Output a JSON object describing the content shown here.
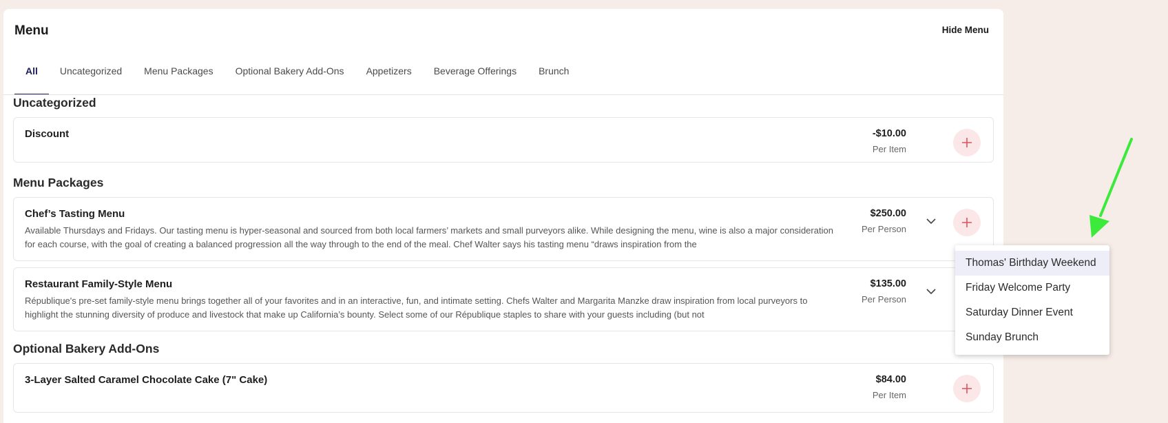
{
  "header": {
    "title": "Menu",
    "hide_label": "Hide Menu"
  },
  "tabs": [
    {
      "label": "All",
      "active": true
    },
    {
      "label": "Uncategorized"
    },
    {
      "label": "Menu Packages"
    },
    {
      "label": "Optional Bakery Add-Ons"
    },
    {
      "label": "Appetizers"
    },
    {
      "label": "Beverage Offerings"
    },
    {
      "label": "Brunch"
    }
  ],
  "sections": {
    "uncategorized": {
      "title": "Uncategorized",
      "items": [
        {
          "name": "Discount",
          "price": "-$10.00",
          "unit": "Per Item"
        }
      ]
    },
    "menu_packages": {
      "title": "Menu Packages",
      "items": [
        {
          "name": "Chef’s Tasting Menu",
          "description": "Available Thursdays and Fridays. Our tasting menu is hyper-seasonal and sourced from both local farmers’ markets and small purveyors alike. While designing the menu, wine is also a major consideration for each course, with the goal of creating a balanced progression all the way through to the end of the meal. Chef Walter says his tasting menu “draws inspiration from the",
          "price": "$250.00",
          "unit": "Per Person"
        },
        {
          "name": "Restaurant Family-Style Menu",
          "description": "République's pre-set family-style menu brings together all of your favorites and in an interactive, fun, and intimate setting. Chefs Walter and Margarita Manzke draw inspiration from local purveyors to highlight the stunning diversity of produce and livestock that make up California’s bounty. Select some of our République staples to share with your guests including (but not",
          "price": "$135.00",
          "unit": "Per Person"
        }
      ]
    },
    "bakery": {
      "title": "Optional Bakery Add-Ons",
      "items": [
        {
          "name": "3-Layer Salted Caramel Chocolate Cake (7\" Cake)",
          "price": "$84.00",
          "unit": "Per Item"
        }
      ]
    }
  },
  "dropdown": {
    "options": [
      "Thomas' Birthday Weekend",
      "Friday Welcome Party",
      "Saturday Dinner Event",
      "Sunday Brunch"
    ],
    "highlighted_index": 0
  },
  "colors": {
    "background": "#f6ece8",
    "accent": "#1e1e5a",
    "add_button_bg": "#fbe7e8",
    "add_button_icon": "#e0505a",
    "annotation_arrow": "#3bea3b"
  },
  "icons": {
    "add": "plus-icon",
    "expand": "chevron-down-icon"
  }
}
